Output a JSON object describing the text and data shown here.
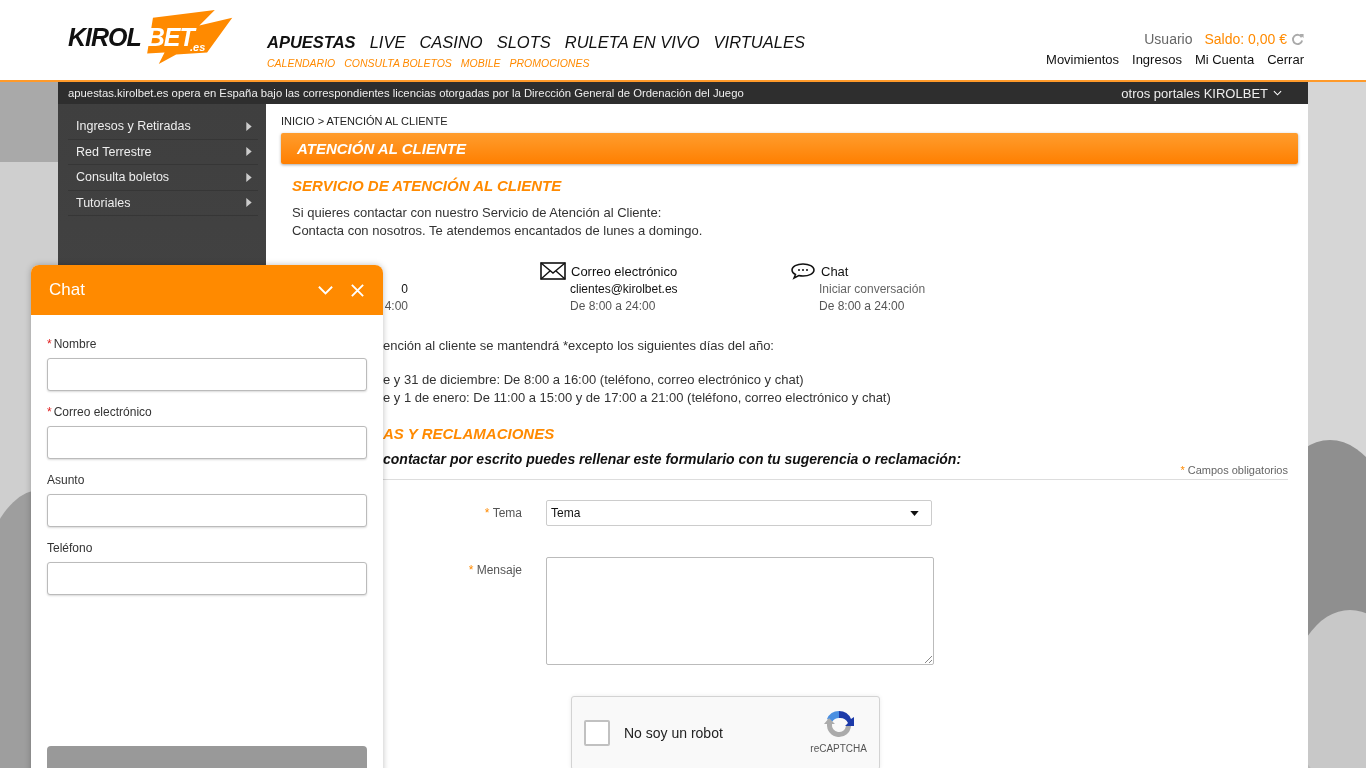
{
  "header": {
    "logo": {
      "main": "KIROL",
      "accent": "BET",
      "suffix": ".es"
    },
    "nav": [
      {
        "label": "APUESTAS",
        "selected": true
      },
      {
        "label": "LIVE",
        "selected": false
      },
      {
        "label": "CASINO",
        "selected": false
      },
      {
        "label": "SLOTS",
        "selected": false
      },
      {
        "label": "RULETA EN VIVO",
        "selected": false
      },
      {
        "label": "VIRTUALES",
        "selected": false
      }
    ],
    "subnav": [
      "CALENDARIO",
      "CONSULTA BOLETOS",
      "MOBILE",
      "PROMOCIONES"
    ],
    "user": "Usuario",
    "balance": "Saldo: 0,00 €",
    "account_links": [
      "Movimientos",
      "Ingresos",
      "Mi Cuenta",
      "Cerrar"
    ]
  },
  "notice": {
    "text": "apuestas.kirolbet.es opera en España bajo las correspondientes licencias otorgadas por la Dirección General de Ordenación del Juego",
    "portals": "otros portales KIROLBET"
  },
  "sidebar": {
    "items": [
      {
        "label": "Ingresos y Retiradas"
      },
      {
        "label": "Red Terrestre"
      },
      {
        "label": "Consulta boletos"
      },
      {
        "label": "Tutoriales"
      }
    ]
  },
  "breadcrumb": "INICIO > ATENCIÓN AL CLIENTE",
  "page_title": "ATENCIÓN AL CLIENTE",
  "section_title": "SERVICIO DE ATENCIÓN AL CLIENTE",
  "intro": [
    "Si quieres contactar con nuestro Servicio de Atención al Cliente:",
    "Contacta con nosotros. Te atendemos encantados de lunes a domingo."
  ],
  "contacts": [
    {
      "kind": "phone",
      "detail": "0",
      "muted": false,
      "hours": "4:00"
    },
    {
      "kind": "email",
      "title": "Correo electrónico",
      "detail": "clientes@kirolbet.es",
      "muted": false,
      "hours": "De 8:00 a 24:00"
    },
    {
      "kind": "chat",
      "title": "Chat",
      "detail": "Iniciar conversación",
      "muted": true,
      "hours": "De 8:00 a 24:00"
    }
  ],
  "exceptions": {
    "intro": "ención al cliente se mantendrá *excepto los siguientes días del año:",
    "days": [
      "e y 31 de diciembre: De 8:00 a 16:00 (teléfono, correo electrónico y chat)",
      "e y 1 de enero: De 11:00 a 15:00 y de 17:00 a 21:00 (teléfono, correo electrónico y chat)"
    ]
  },
  "complaints": {
    "title": "AS Y RECLAMACIONES",
    "lead": "contactar por escrito puedes rellenar este formulario con tu sugerencia o reclamación:",
    "required_note": {
      "mark": "*",
      "text": "Campos obligatorios"
    },
    "fields": [
      {
        "kind": "select",
        "label": "Tema",
        "required_mark": "*",
        "value": "Tema"
      },
      {
        "kind": "textarea",
        "label": "Mensaje",
        "required_mark": "*"
      }
    ],
    "captcha": {
      "label": "No soy un robot",
      "brand": "reCAPTCHA",
      "checked": false
    }
  },
  "chat": {
    "title": "Chat",
    "fields": [
      {
        "label": "Nombre",
        "required_mark": "*"
      },
      {
        "label": "Correo electrónico",
        "required_mark": "*"
      },
      {
        "label": "Asunto"
      },
      {
        "label": "Teléfono"
      }
    ]
  }
}
